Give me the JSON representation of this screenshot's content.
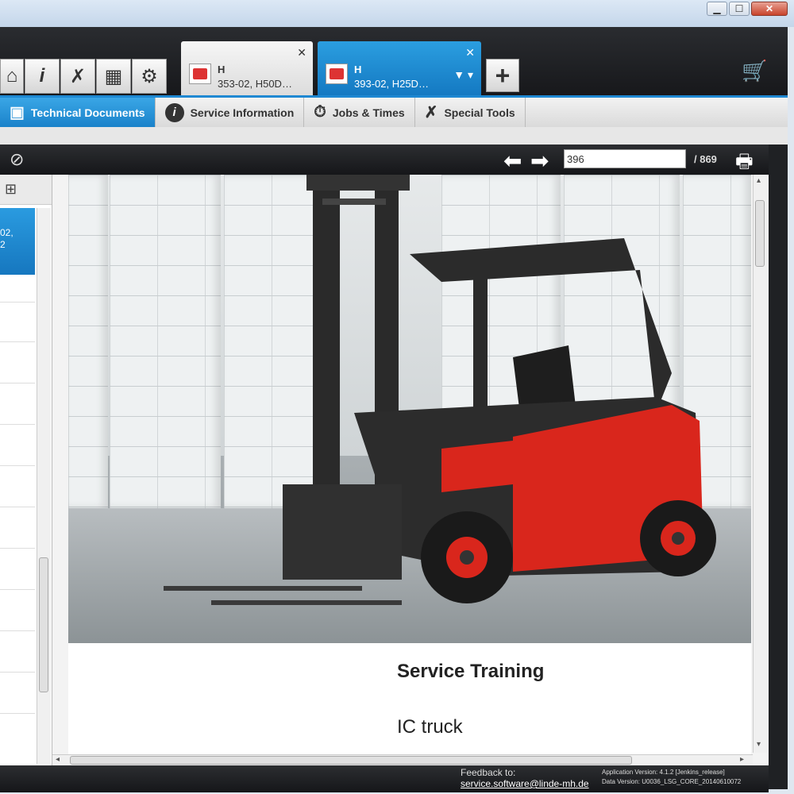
{
  "window": {
    "minimize": "▁",
    "maximize": "☐",
    "close": "✕"
  },
  "toolbar": {
    "icons": [
      "home-icon",
      "info-icon",
      "tools-icon",
      "vehicle-icon",
      "gear-icon"
    ],
    "glyphs": [
      "⌂",
      "i",
      "✗",
      "▦",
      "⚙"
    ],
    "plus": "+",
    "cart": "🛒"
  },
  "tabs": [
    {
      "title": "H",
      "subtitle": "353-02, H50D…",
      "close": "✕"
    },
    {
      "title": "H",
      "subtitle": "393-02, H25D…",
      "close": "✕",
      "filter": "▼ ▾"
    }
  ],
  "function_tabs": [
    {
      "label": "Technical Documents",
      "icon": "▣"
    },
    {
      "label": "Service Information",
      "icon": "i"
    },
    {
      "label": "Jobs & Times",
      "icon": "⏱"
    },
    {
      "label": "Special Tools",
      "icon": "✗"
    }
  ],
  "doc_toolbar": {
    "filter_icon": "⊘",
    "prev": "⬅",
    "next": "➡",
    "page_value": "396",
    "page_total": "/  869",
    "print": "🖶"
  },
  "left_panel": {
    "tree_icon": "⊞",
    "selected_text": "02,\n2"
  },
  "document": {
    "title": "Service Training",
    "subtitle": "IC truck",
    "scroll_up": "▴",
    "scroll_down": "▾",
    "scroll_left": "◂",
    "scroll_right": "▸"
  },
  "footer": {
    "feedback_label": "Feedback to:",
    "feedback_email": "service.software@linde-mh.de",
    "app_version": "Application Version: 4.1.2 [Jenkins_release]",
    "data_version": "Data Version: U0036_LSG_CORE_20140610072"
  }
}
